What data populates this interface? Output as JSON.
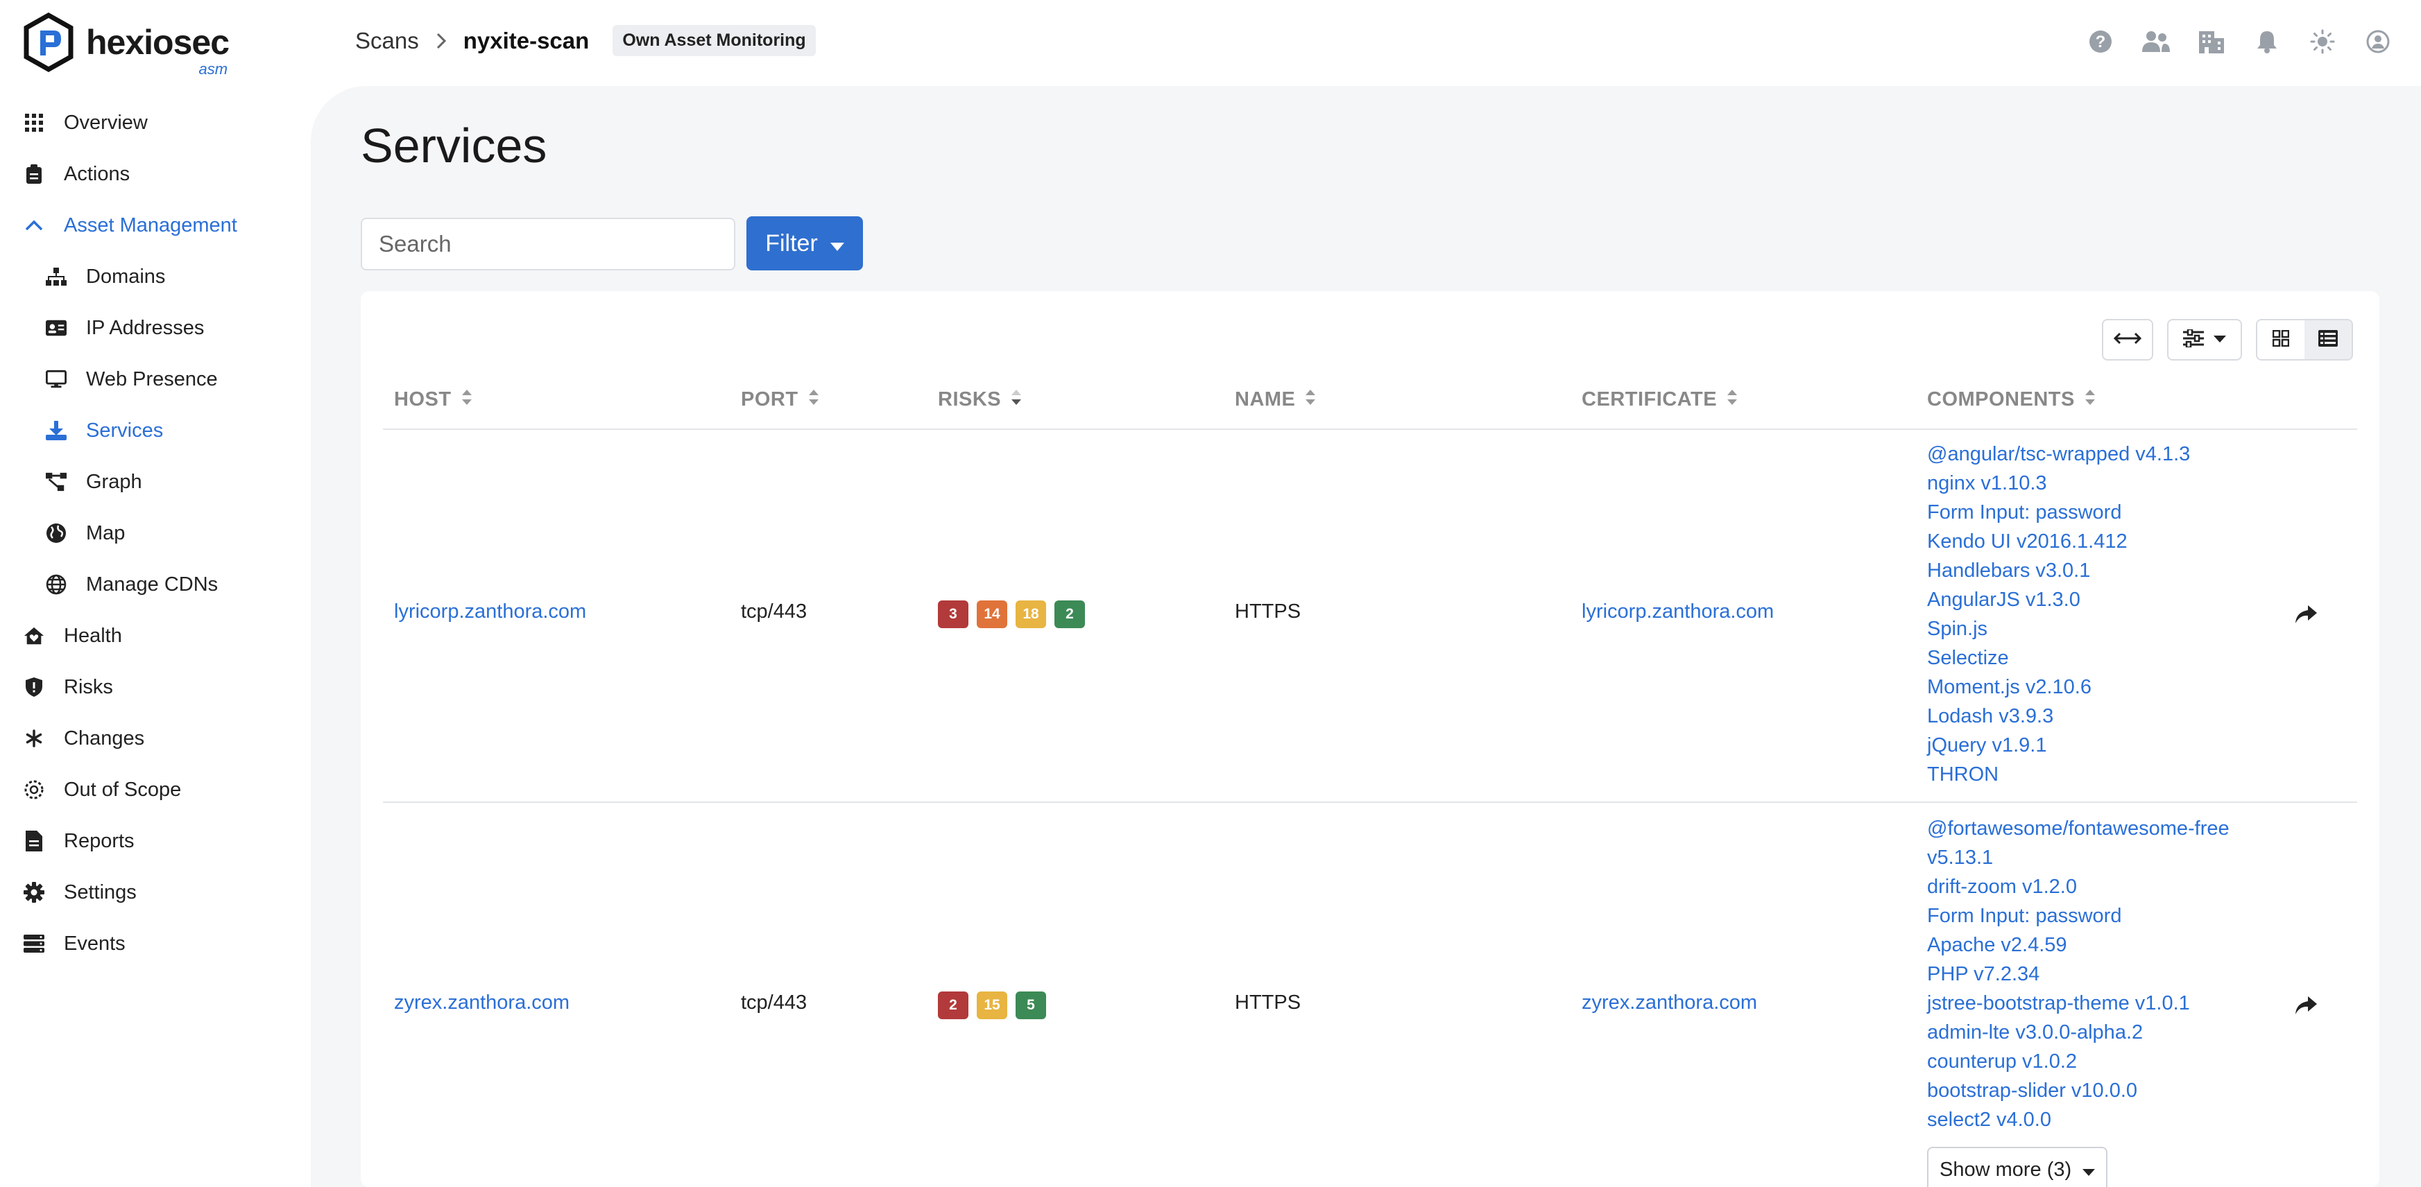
{
  "app": {
    "brand": "hexiosec",
    "brand_sub": "asm"
  },
  "sidebar": {
    "items": [
      {
        "label": "Overview",
        "icon": "grid-icon"
      },
      {
        "label": "Actions",
        "icon": "clipboard-icon"
      },
      {
        "label": "Asset Management",
        "icon": "chevron-up-icon"
      },
      {
        "label": "Domains",
        "icon": "sitemap-icon"
      },
      {
        "label": "IP Addresses",
        "icon": "id-card-icon"
      },
      {
        "label": "Web Presence",
        "icon": "monitor-icon"
      },
      {
        "label": "Services",
        "icon": "download-icon"
      },
      {
        "label": "Graph",
        "icon": "graph-icon"
      },
      {
        "label": "Map",
        "icon": "globe-icon"
      },
      {
        "label": "Manage CDNs",
        "icon": "globe-grid-icon"
      },
      {
        "label": "Health",
        "icon": "house-heart-icon"
      },
      {
        "label": "Risks",
        "icon": "shield-icon"
      },
      {
        "label": "Changes",
        "icon": "asterisk-icon"
      },
      {
        "label": "Out of Scope",
        "icon": "dashed-circle-icon"
      },
      {
        "label": "Reports",
        "icon": "file-icon"
      },
      {
        "label": "Settings",
        "icon": "gear-icon"
      },
      {
        "label": "Events",
        "icon": "server-icon"
      }
    ]
  },
  "header": {
    "breadcrumb_root": "Scans",
    "breadcrumb_current": "nyxite-scan",
    "badge": "Own Asset Monitoring",
    "icons": [
      "help-icon",
      "users-icon",
      "building-icon",
      "bell-icon",
      "sun-icon",
      "account-icon"
    ]
  },
  "main": {
    "title": "Services",
    "search_placeholder": "Search",
    "filter_label": "Filter"
  },
  "table": {
    "columns": [
      "HOST",
      "PORT",
      "RISKS",
      "NAME",
      "CERTIFICATE",
      "COMPONENTS"
    ],
    "rows": [
      {
        "host": "lyricorp.zanthora.com",
        "port": "tcp/443",
        "risks": [
          {
            "value": "3",
            "color": "#b23a3a"
          },
          {
            "value": "14",
            "color": "#e0733a"
          },
          {
            "value": "18",
            "color": "#e8b442"
          },
          {
            "value": "2",
            "color": "#3c8a56"
          }
        ],
        "name": "HTTPS",
        "certificate": "lyricorp.zanthora.com",
        "components": [
          "@angular/tsc-wrapped v4.1.3",
          "nginx v1.10.3",
          "Form Input: password",
          "Kendo UI v2016.1.412",
          "Handlebars v3.0.1",
          "AngularJS v1.3.0",
          "Spin.js",
          "Selectize",
          "Moment.js v2.10.6",
          "Lodash v3.9.3",
          "jQuery v1.9.1",
          "THRON"
        ]
      },
      {
        "host": "zyrex.zanthora.com",
        "port": "tcp/443",
        "risks": [
          {
            "value": "2",
            "color": "#b23a3a"
          },
          {
            "value": "15",
            "color": "#e8b442"
          },
          {
            "value": "5",
            "color": "#3c8a56"
          }
        ],
        "name": "HTTPS",
        "certificate": "zyrex.zanthora.com",
        "components": [
          "@fortawesome/fontawesome-free v5.13.1",
          "drift-zoom v1.2.0",
          "Form Input: password",
          "Apache v2.4.59",
          "PHP v7.2.34",
          "jstree-bootstrap-theme v1.0.1",
          "admin-lte v3.0.0-alpha.2",
          "counterup v1.0.2",
          "bootstrap-slider v10.0.0",
          "select2 v4.0.0"
        ],
        "show_more": "Show more (3)"
      }
    ]
  }
}
